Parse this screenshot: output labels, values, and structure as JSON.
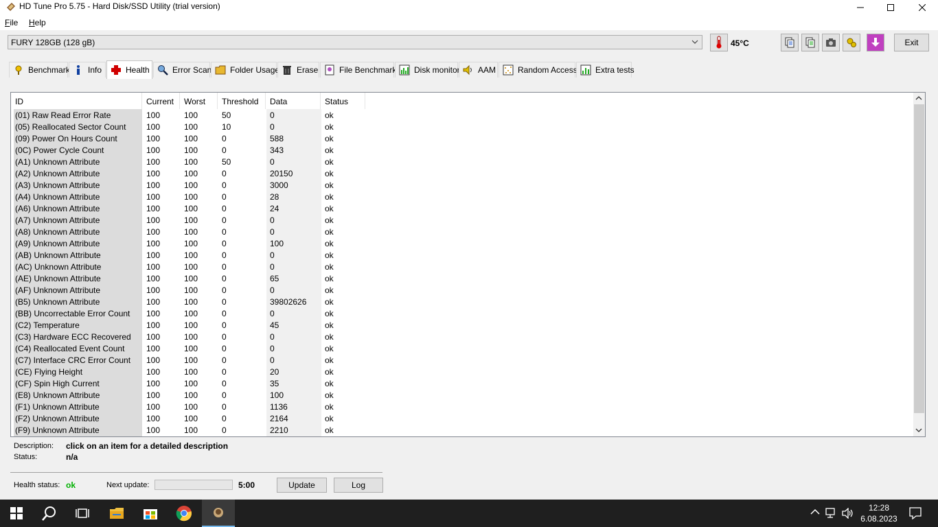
{
  "window": {
    "title": "HD Tune Pro 5.75 - Hard Disk/SSD Utility (trial version)"
  },
  "menu": [
    {
      "label": "File",
      "mnemonic": "F",
      "rest": "ile"
    },
    {
      "label": "Help",
      "mnemonic": "H",
      "rest": "elp"
    }
  ],
  "toolbar": {
    "drive": "FURY 128GB (128 gB)",
    "temperature": "45°C",
    "exit_label": "Exit",
    "icons": [
      "copy-icon",
      "copy-all-icon",
      "screenshot-icon",
      "options-icon",
      "save-icon"
    ]
  },
  "tabs": [
    {
      "label": "Benchmark",
      "icon": "benchmark-icon"
    },
    {
      "label": "Info",
      "icon": "info-icon"
    },
    {
      "label": "Health",
      "icon": "health-icon",
      "active": true
    },
    {
      "label": "Error Scan",
      "icon": "error-scan-icon"
    },
    {
      "label": "Folder Usage",
      "icon": "folder-icon"
    },
    {
      "label": "Erase",
      "icon": "erase-icon"
    },
    {
      "label": "File Benchmark",
      "icon": "file-benchmark-icon"
    },
    {
      "label": "Disk monitor",
      "icon": "disk-monitor-icon"
    },
    {
      "label": "AAM",
      "icon": "speaker-icon"
    },
    {
      "label": "Random Access",
      "icon": "random-access-icon"
    },
    {
      "label": "Extra tests",
      "icon": "extra-tests-icon"
    }
  ],
  "table": {
    "columns": [
      "ID",
      "Current",
      "Worst",
      "Threshold",
      "Data",
      "Status"
    ],
    "rows": [
      [
        "(01) Raw Read Error Rate",
        "100",
        "100",
        "50",
        "0",
        "ok"
      ],
      [
        "(05) Reallocated Sector Count",
        "100",
        "100",
        "10",
        "0",
        "ok"
      ],
      [
        "(09) Power On Hours Count",
        "100",
        "100",
        "0",
        "588",
        "ok"
      ],
      [
        "(0C) Power Cycle Count",
        "100",
        "100",
        "0",
        "343",
        "ok"
      ],
      [
        "(A1) Unknown Attribute",
        "100",
        "100",
        "50",
        "0",
        "ok"
      ],
      [
        "(A2) Unknown Attribute",
        "100",
        "100",
        "0",
        "20150",
        "ok"
      ],
      [
        "(A3) Unknown Attribute",
        "100",
        "100",
        "0",
        "3000",
        "ok"
      ],
      [
        "(A4) Unknown Attribute",
        "100",
        "100",
        "0",
        "28",
        "ok"
      ],
      [
        "(A6) Unknown Attribute",
        "100",
        "100",
        "0",
        "24",
        "ok"
      ],
      [
        "(A7) Unknown Attribute",
        "100",
        "100",
        "0",
        "0",
        "ok"
      ],
      [
        "(A8) Unknown Attribute",
        "100",
        "100",
        "0",
        "0",
        "ok"
      ],
      [
        "(A9) Unknown Attribute",
        "100",
        "100",
        "0",
        "100",
        "ok"
      ],
      [
        "(AB) Unknown Attribute",
        "100",
        "100",
        "0",
        "0",
        "ok"
      ],
      [
        "(AC) Unknown Attribute",
        "100",
        "100",
        "0",
        "0",
        "ok"
      ],
      [
        "(AE) Unknown Attribute",
        "100",
        "100",
        "0",
        "65",
        "ok"
      ],
      [
        "(AF) Unknown Attribute",
        "100",
        "100",
        "0",
        "0",
        "ok"
      ],
      [
        "(B5) Unknown Attribute",
        "100",
        "100",
        "0",
        "39802626",
        "ok"
      ],
      [
        "(BB) Uncorrectable Error Count",
        "100",
        "100",
        "0",
        "0",
        "ok"
      ],
      [
        "(C2) Temperature",
        "100",
        "100",
        "0",
        "45",
        "ok"
      ],
      [
        "(C3) Hardware ECC Recovered",
        "100",
        "100",
        "0",
        "0",
        "ok"
      ],
      [
        "(C4) Reallocated Event Count",
        "100",
        "100",
        "0",
        "0",
        "ok"
      ],
      [
        "(C7) Interface CRC Error Count",
        "100",
        "100",
        "0",
        "0",
        "ok"
      ],
      [
        "(CE) Flying Height",
        "100",
        "100",
        "0",
        "20",
        "ok"
      ],
      [
        "(CF) Spin High Current",
        "100",
        "100",
        "0",
        "35",
        "ok"
      ],
      [
        "(E8) Unknown Attribute",
        "100",
        "100",
        "0",
        "100",
        "ok"
      ],
      [
        "(F1) Unknown Attribute",
        "100",
        "100",
        "0",
        "1136",
        "ok"
      ],
      [
        "(F2) Unknown Attribute",
        "100",
        "100",
        "0",
        "2164",
        "ok"
      ],
      [
        "(F9) Unknown Attribute",
        "100",
        "100",
        "0",
        "2210",
        "ok"
      ]
    ]
  },
  "details": {
    "description_label": "Description:",
    "description_value": "click on an item for a detailed description",
    "status_label": "Status:",
    "status_value": "n/a"
  },
  "footer": {
    "health_label": "Health status:",
    "health_value": "ok",
    "next_update_label": "Next update:",
    "next_update_progress": 0,
    "next_update_time": "5:00",
    "update_label": "Update",
    "log_label": "Log"
  },
  "taskbar": {
    "time": "12:28",
    "date": "6.08.2023"
  },
  "colors": {
    "ok_green": "#00b000",
    "taskbar": "#1f1f1f",
    "accent_blue": "#76b9ed"
  }
}
